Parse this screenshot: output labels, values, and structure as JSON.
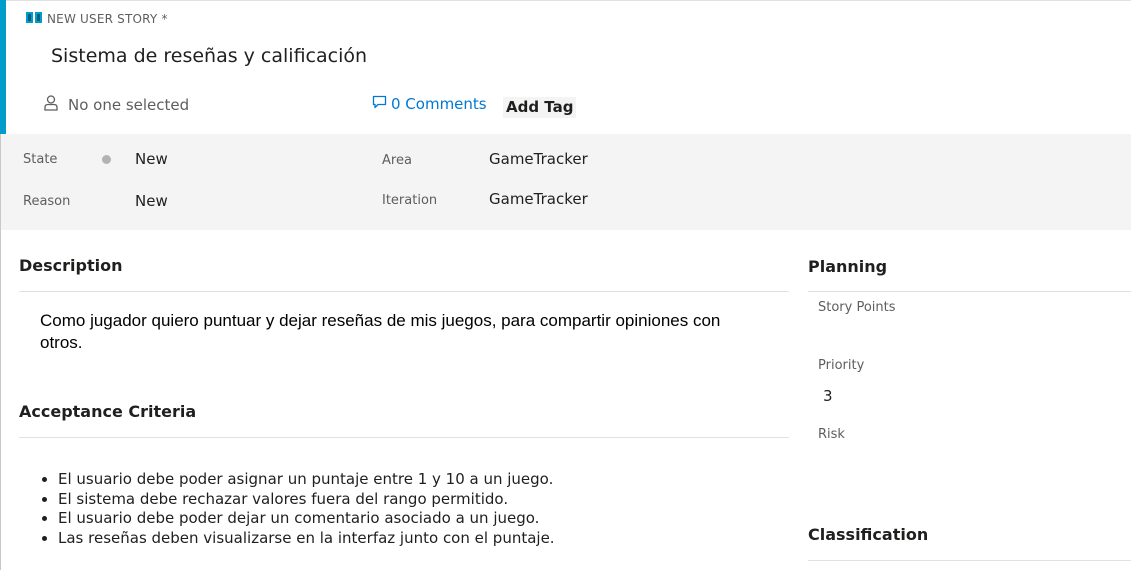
{
  "header": {
    "type_label": "NEW USER STORY *",
    "title": "Sistema de reseñas y calificación",
    "assignee": "No one selected",
    "comments": "0 Comments",
    "add_tag": "Add Tag"
  },
  "fields": {
    "state_label": "State",
    "state_value": "New",
    "reason_label": "Reason",
    "reason_value": "New",
    "area_label": "Area",
    "area_value": "GameTracker",
    "iteration_label": "Iteration",
    "iteration_value": "GameTracker"
  },
  "description": {
    "title": "Description",
    "text": "Como jugador quiero puntuar y dejar reseñas de mis juegos, para compartir opiniones con otros."
  },
  "acceptance": {
    "title": "Acceptance Criteria",
    "items": [
      "El usuario debe poder asignar un puntaje entre 1 y 10 a un juego.",
      "El sistema debe rechazar valores fuera del rango permitido.",
      "El usuario debe poder dejar un comentario asociado a un juego.",
      "Las reseñas deben visualizarse en la interfaz junto con el puntaje."
    ]
  },
  "planning": {
    "title": "Planning",
    "story_points_label": "Story Points",
    "story_points_value": "",
    "priority_label": "Priority",
    "priority_value": "3",
    "risk_label": "Risk",
    "risk_value": ""
  },
  "classification": {
    "title": "Classification"
  },
  "colors": {
    "accent": "#009ccc",
    "link": "#0078d4",
    "state_new": "#b2b2b2"
  },
  "icons": {
    "work_item_type": "book-icon",
    "assignee": "person-icon",
    "comments": "comment-icon"
  }
}
